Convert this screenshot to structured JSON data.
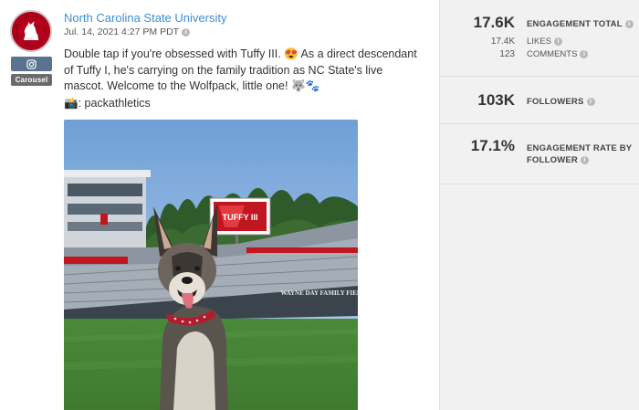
{
  "post": {
    "network_badge_icon": "instagram-icon",
    "type_badge": "Carousel",
    "author": "North Carolina State University",
    "timestamp": "Jul. 14, 2021 4:27 PM PDT",
    "caption": "Double tap if you're obsessed with Tuffy III. 😍 As a direct descendant of Tuffy I, he's carrying on the family tradition as NC State's live mascot. Welcome to the Wolfpack, little one! 🐺🐾",
    "credit": "📸: packathletics",
    "photo": {
      "scoreboard_text": "TUFFY III",
      "stadium_text": "WAYNE DAY FAMILY FIELD"
    }
  },
  "stats": {
    "engagement_total": {
      "value": "17.6K",
      "label": "ENGAGEMENT TOTAL"
    },
    "likes": {
      "value": "17.4K",
      "label": "LIKES"
    },
    "comments": {
      "value": "123",
      "label": "COMMENTS"
    },
    "followers": {
      "value": "103K",
      "label": "FOLLOWERS"
    },
    "engagement_rate": {
      "value": "17.1%",
      "label_line1": "ENGAGEMENT RATE BY",
      "label_line2": "FOLLOWER"
    }
  },
  "colors": {
    "brand_red": "#b3001b",
    "link_blue": "#3d8fd4",
    "panel_bg": "#f1f1f1"
  }
}
